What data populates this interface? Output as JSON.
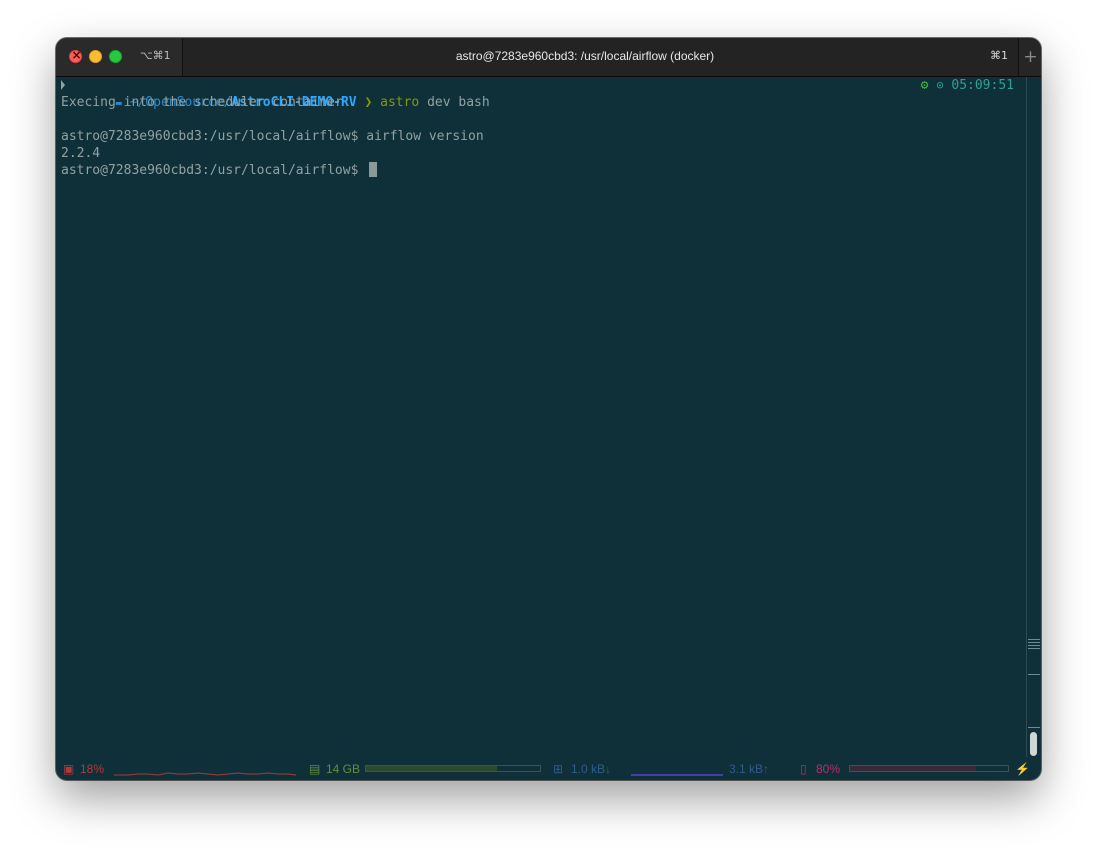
{
  "window": {
    "title": "astro@7283e960cbd3: /usr/local/airflow (docker)",
    "tab_shortcut": "⌥⌘1",
    "title_shortcut": "⌘1",
    "new_tab_glyph": "+"
  },
  "prompt": {
    "apple_glyph": "",
    "folder_glyph": "▬",
    "path_prefix": "~/OpenSource/",
    "path_dir": "AstroCLI-DEMO-RV",
    "chevron": "❯",
    "command": "astro",
    "command_args": " dev bash",
    "status_gear": "⚙",
    "status_clock_glyph": "⊙",
    "time": "05:09:51"
  },
  "output": {
    "line1": "Execing into the scheduler container",
    "line2": "astro@7283e960cbd3:/usr/local/airflow$ airflow version",
    "line3": "2.2.4",
    "line4": "astro@7283e960cbd3:/usr/local/airflow$ "
  },
  "statusbar": {
    "cpu_icon": "▣",
    "cpu": "18%",
    "mem_icon": "▤",
    "mem": "14 GB",
    "mem_fraction": 0.75,
    "net_icon": "⊞",
    "net_down": "1.0 kB↓",
    "net_up": "3.1 kB↑",
    "battery_icon": "▯",
    "battery": "80%",
    "battery_fraction": 0.8,
    "bolt_icon": "⚡"
  },
  "colors": {
    "background": "#0f3039",
    "text": "#93a1a1",
    "path": "#268bd2",
    "command": "#859900",
    "cpu": "#b03a3a",
    "mem": "#5f8f3a",
    "net": "#2f5d8a",
    "battery": "#b3306a"
  }
}
